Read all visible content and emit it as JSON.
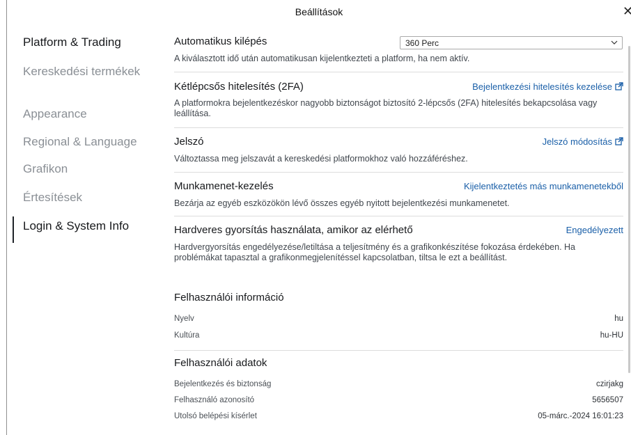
{
  "window": {
    "title": "Beállítások",
    "close_glyph": "✕"
  },
  "sidebar": {
    "items": [
      {
        "label": "Platform & Trading",
        "state": "active"
      },
      {
        "label": "Kereskedési termékek",
        "state": "normal"
      },
      {
        "label": "Appearance",
        "state": "normal"
      },
      {
        "label": "Regional & Language",
        "state": "normal"
      },
      {
        "label": "Grafikon",
        "state": "normal"
      },
      {
        "label": "Értesítések",
        "state": "normal"
      },
      {
        "label": "Login & System Info",
        "state": "selected"
      }
    ]
  },
  "settings": {
    "autologout": {
      "title": "Automatikus kilépés",
      "select_value": "360 Perc",
      "description": "A kiválasztott idő után automatikusan kijelentkezteti a platform, ha nem aktív."
    },
    "twofa": {
      "title": "Kétlépcsős hitelesítés (2FA)",
      "link": "Bejelentkezési hitelesítés kezelése",
      "description": "A platformokra bejelentkezéskor nagyobb biztonságot biztosító 2-lépcsős (2FA) hitelesítés bekapcsolása vagy leállítása."
    },
    "password": {
      "title": "Jelszó",
      "link": "Jelszó módosítás",
      "description": "Változtassa meg jelszavát a kereskedési platformokhoz való hozzáféréshez."
    },
    "sessions": {
      "title": "Munkamenet-kezelés",
      "link": "Kijelentkeztetés más munkamenetekből",
      "description": "Bezárja az egyéb eszközökön lévő összes egyéb nyitott bejelentkezési munkamenetet."
    },
    "hwaccel": {
      "title": "Hardveres gyorsítás használata, amikor az elérhető",
      "link": "Engedélyezett",
      "description": "Hardvergyorsítás engedélyezése/letiltása a teljesítmény és a grafikonkészítése fokozása érdekében. Ha problémákat tapasztal a grafikonmegjelenítéssel kapcsolatban, tiltsa le ezt a beállítást."
    }
  },
  "user_info": {
    "title": "Felhasználói információ",
    "rows": [
      {
        "key": "Nyelv",
        "value": "hu"
      },
      {
        "key": "Kultúra",
        "value": "hu-HU"
      }
    ]
  },
  "user_data": {
    "title": "Felhasználói adatok",
    "rows": [
      {
        "key": "Bejelentkezés és biztonság",
        "value": "czirjakg"
      },
      {
        "key": "Felhasználó azonosító",
        "value": "5656507"
      },
      {
        "key": "Utolsó belépési kísérlet",
        "value": "05-márc.-2024 16:01:23"
      }
    ]
  },
  "colors": {
    "link": "#1a5fa8",
    "active_text": "#17191c",
    "muted_text": "#8a8f95"
  }
}
